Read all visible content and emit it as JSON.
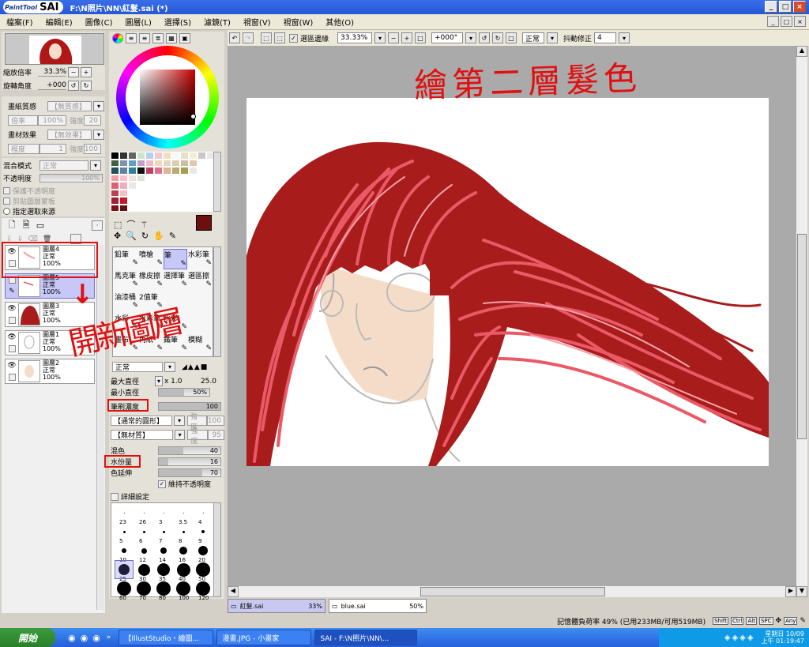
{
  "window": {
    "app_logo": "PaintTool",
    "app_name": "SAI",
    "title": "F:\\N照片\\NN\\紅髮.sai (*)",
    "minimize": "_",
    "maximize": "□",
    "close": "×"
  },
  "menu": [
    "檔案(F)",
    "編輯(E)",
    "圖像(C)",
    "圖層(L)",
    "選擇(S)",
    "濾鏡(T)",
    "視窗(V)",
    "視窗(W)",
    "其他(O)"
  ],
  "navigator": {
    "zoom_label": "縮放倍率",
    "zoom_value": "33.3%",
    "angle_label": "旋轉角度",
    "angle_value": "+000"
  },
  "paper": {
    "texture_label": "畫紙質感",
    "texture_value": "【無質感】",
    "scale_label": "倍率",
    "scale_value": "100%",
    "strength_label": "強度",
    "strength_value": "20",
    "effect_label": "畫材效果",
    "effect_value": "【無效果】",
    "degree_label": "程度",
    "degree_value": "1",
    "strength2_label": "強度",
    "strength2_value": "100"
  },
  "blend": {
    "mode_label": "混合模式",
    "mode_value": "正常",
    "opacity_label": "不透明度",
    "opacity_value": "100%",
    "preserve": "保護不透明度",
    "clip": "剪貼圖層蒙板",
    "select_src": "指定選取來源"
  },
  "layers": [
    {
      "name": "圖層4",
      "mode": "正常",
      "opacity": "100%",
      "selected": false
    },
    {
      "name": "圖層5",
      "mode": "正常",
      "opacity": "100%",
      "selected": true
    },
    {
      "name": "圖層3",
      "mode": "正常",
      "opacity": "100%",
      "selected": false
    },
    {
      "name": "圖層1",
      "mode": "正常",
      "opacity": "100%",
      "selected": false
    },
    {
      "name": "圖層2",
      "mode": "正常",
      "opacity": "100%",
      "selected": false
    }
  ],
  "tools": [
    [
      "鉛筆",
      "噴槍",
      "筆",
      "水彩筆"
    ],
    [
      "馬克筆",
      "橡皮擦",
      "選擇筆",
      "選區擦"
    ],
    [
      "油漆桶",
      "2值筆",
      "",
      ""
    ],
    [
      "水彩",
      "水彩筆",
      "水彩",
      ""
    ],
    [
      "畫布",
      "內紙",
      "鐵筆",
      "模糊"
    ]
  ],
  "brush": {
    "mode_value": "正常",
    "max_size_label": "最大直徑",
    "max_size_mult": "x 1.0",
    "max_size_value": "25.0",
    "min_size_label": "最小直徑",
    "min_size_value": "50%",
    "density_label": "筆刷濃度",
    "density_value": "100",
    "shape_value": "【通常的圓形】",
    "shape_strength_label": "強度",
    "shape_strength_value": "100",
    "texture_value": "【無材質】",
    "texture_strength_label": "強度",
    "texture_strength_value": "95",
    "blend_label": "混色",
    "blend_value": "40",
    "water_label": "水份量",
    "water_value": "16",
    "extend_label": "色延伸",
    "extend_value": "70",
    "keep_opacity": "維持不透明度",
    "detail": "詳細設定"
  },
  "brush_sizes": [
    [
      "23",
      "26",
      "3",
      "3.5",
      "4"
    ],
    [
      "5",
      "6",
      "7",
      "8",
      "9"
    ],
    [
      "10",
      "12",
      "14",
      "16",
      "20"
    ],
    [
      "25",
      "30",
      "35",
      "40",
      "50"
    ],
    [
      "60",
      "70",
      "80",
      "100",
      "120"
    ]
  ],
  "toolbar": {
    "selection_edge": "選區邊緣",
    "zoom": "33.33%",
    "angle": "+000°",
    "blend_mode": "正常",
    "stabilizer_label": "抖動修正",
    "stabilizer_value": "4"
  },
  "annotations": {
    "title": "繪第二層髮色",
    "side": "開新圖層"
  },
  "tabs": [
    {
      "name": "紅髮.sai",
      "zoom": "33%"
    },
    {
      "name": "blue.sai",
      "zoom": "50%"
    }
  ],
  "status": {
    "memory": "記憶體負荷率 49% (已用233MB/可用519MB)",
    "keys": [
      "Shift",
      "Ctrl",
      "Alt",
      "SPC",
      "Any"
    ]
  },
  "taskbar": {
    "start": "開始",
    "tasks": [
      "【IllustStudio・繪圖...",
      "漫畫.JPG - 小畫家",
      "SAI - F:\\N照片\\NN\\..."
    ],
    "clock_line1": "星期日 10/09",
    "clock_line2": "上午 01:19:47"
  },
  "colors": {
    "current": "#6b0f0f",
    "hair_dark": "#a81c1c",
    "hair_light": "#e8505a",
    "annotation": "#e01010"
  }
}
